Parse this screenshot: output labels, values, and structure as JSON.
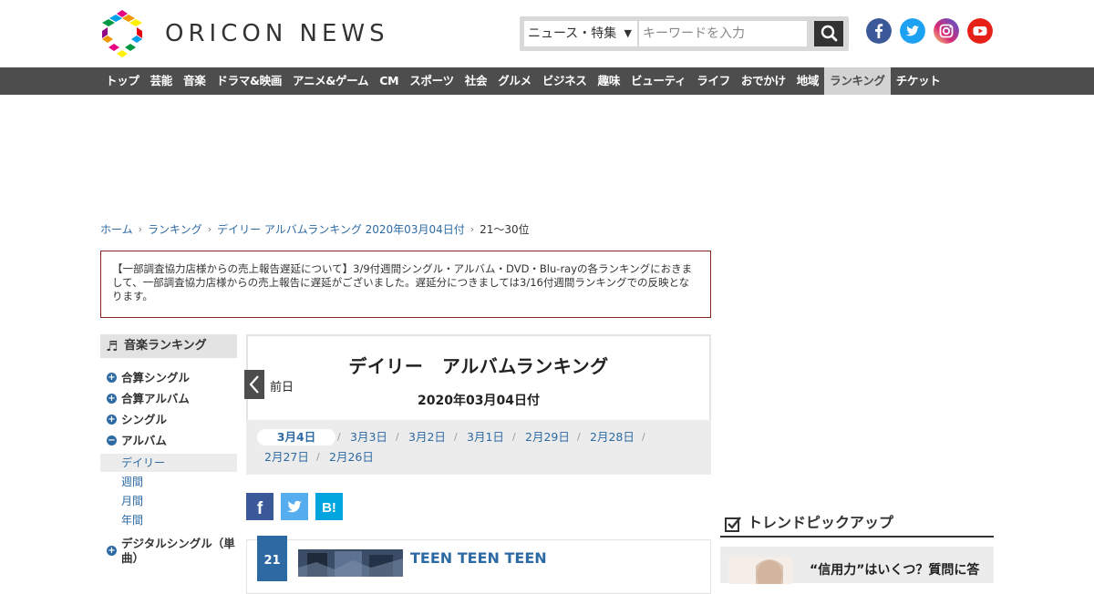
{
  "header": {
    "logo_text": "ORICON NEWS",
    "search_category": "ニュース・特集",
    "search_placeholder": "キーワードを入力",
    "social": [
      "facebook-icon",
      "twitter-icon",
      "instagram-icon",
      "youtube-icon"
    ]
  },
  "nav": {
    "items": [
      "トップ",
      "芸能",
      "音楽",
      "ドラマ&映画",
      "アニメ&ゲーム",
      "CM",
      "スポーツ",
      "社会",
      "グルメ",
      "ビジネス",
      "趣味",
      "ビューティ",
      "ライフ",
      "おでかけ",
      "地域",
      "ランキング",
      "チケット"
    ],
    "active": "ランキング"
  },
  "breadcrumb": {
    "home": "ホーム",
    "ranking": "ランキング",
    "daily": "デイリー アルバムランキング 2020年03月04日付",
    "current": "21～30位"
  },
  "notice": "【一部調査協力店様からの売上報告遅延について】3/9付週間シングル・アルバム・DVD・Blu-rayの各ランキングにおきまして、一部調査協力店様からの売上報告に遅延がございました。遅延分につきましては3/16付週間ランキングでの反映となります。",
  "sidebar": {
    "heading": "音楽ランキング",
    "items": {
      "combined_single": "合算シングル",
      "combined_album": "合算アルバム",
      "single": "シングル",
      "album": "アルバム",
      "digital_single": "デジタルシングル（単曲）"
    },
    "album_sub": {
      "daily": "デイリー",
      "weekly": "週間",
      "monthly": "月間",
      "yearly": "年間"
    }
  },
  "main": {
    "title": "デイリー　アルバムランキング",
    "date": "2020年03月04日付",
    "prev_label": "前日",
    "dates": [
      "3月4日",
      "3月3日",
      "3月2日",
      "3月1日",
      "2月29日",
      "2月28日",
      "2月27日",
      "2月26日"
    ],
    "active_date": "3月4日"
  },
  "share": {
    "facebook": "f",
    "hatena": "B!"
  },
  "entry": {
    "rank": "21",
    "title": "TEEN TEEN TEEN"
  },
  "trend": {
    "heading": "トレンドピックアップ",
    "card_text": "“信用力”はいくつ？質問に答"
  },
  "colors": {
    "nav_bg": "#4d4d4d",
    "link_blue": "#2d6aa3",
    "notice_border": "#8a1f1f"
  }
}
